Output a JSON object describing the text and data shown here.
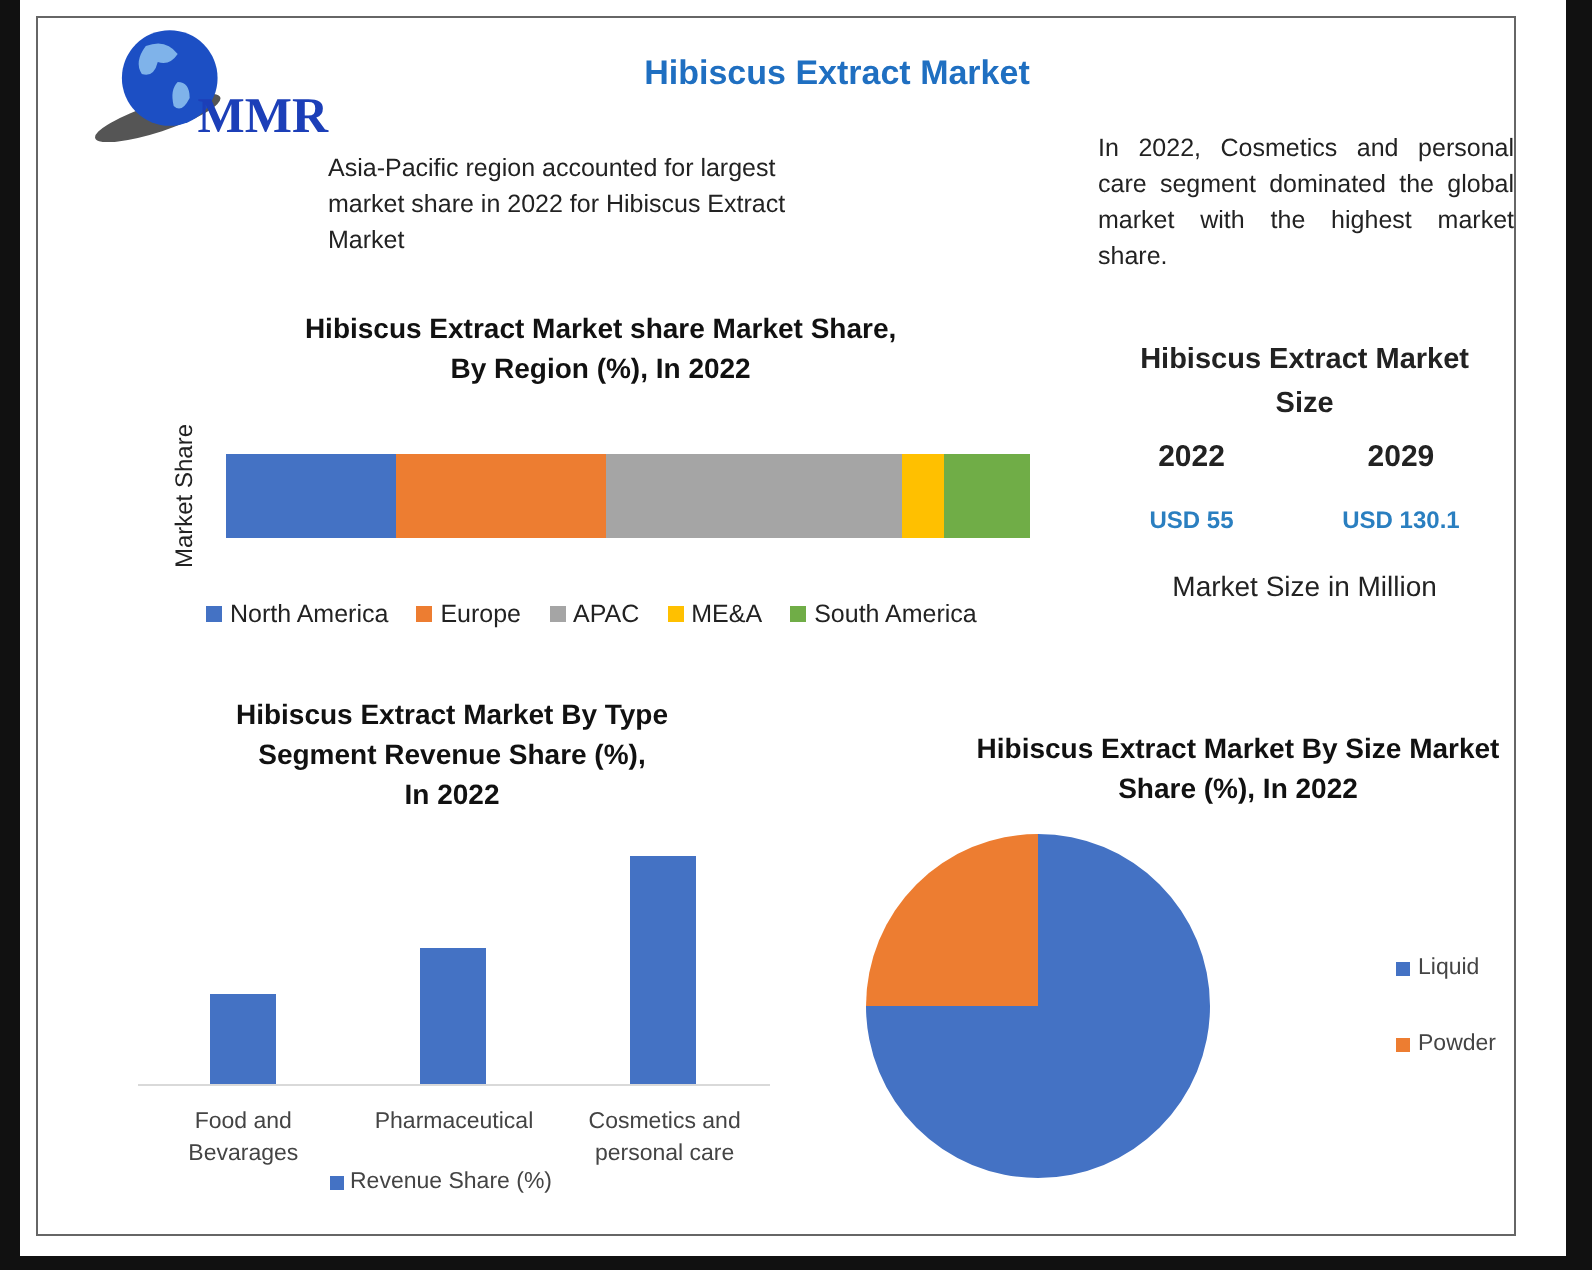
{
  "logo": {
    "text": "MMR"
  },
  "title": "Hibiscus Extract Market",
  "notes": [
    "Asia-Pacific region accounted for largest market share in 2022 for Hibiscus Extract Market",
    "In 2022, Cosmetics and personal care segment dominated the global market with the highest market share."
  ],
  "region_chart": {
    "title_lines": [
      "Hibiscus Extract Market share Market Share,",
      "By Region (%), In 2022"
    ],
    "ylabel": "Market Share",
    "legend": [
      {
        "label": "North America",
        "color": "#4472c4"
      },
      {
        "label": "Europe",
        "color": "#ed7d31"
      },
      {
        "label": "APAC",
        "color": "#a5a5a5"
      },
      {
        "label": "ME&A",
        "color": "#ffc000"
      },
      {
        "label": "South America",
        "color": "#70ad47"
      }
    ]
  },
  "market_size": {
    "title_lines": [
      "Hibiscus Extract Market",
      "Size"
    ],
    "columns": [
      {
        "year": "2022",
        "value": "USD 55"
      },
      {
        "year": "2029",
        "value": "USD 130.1"
      }
    ],
    "unit": "Market Size in Million"
  },
  "type_chart": {
    "title_lines": [
      "Hibiscus Extract Market By Type",
      "Segment Revenue Share (%),",
      "In 2022"
    ],
    "categories": [
      [
        "Food and",
        "Bevarages"
      ],
      [
        "Pharmaceutical"
      ],
      [
        "Cosmetics and",
        "personal care"
      ]
    ],
    "legend": {
      "label": "Revenue Share (%)",
      "color": "#4472c4"
    }
  },
  "size_chart": {
    "title_lines": [
      "Hibiscus Extract Market By Size Market",
      "Share (%), In 2022"
    ],
    "legend": [
      {
        "label": "Liquid",
        "color": "#4472c4"
      },
      {
        "label": "Powder",
        "color": "#ed7d31"
      }
    ]
  }
}
